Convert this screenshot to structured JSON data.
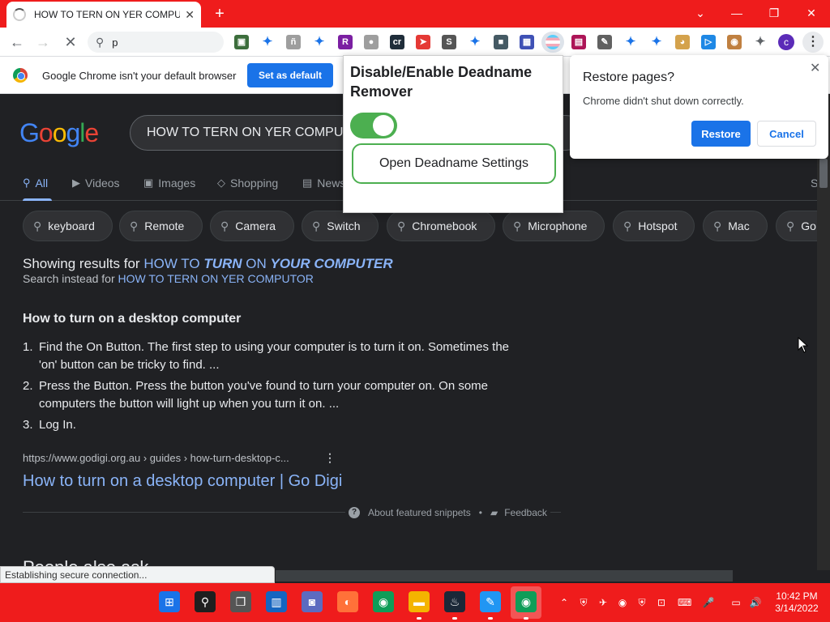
{
  "window": {
    "tab_title": "HOW TO TERN ON YER COMPUTOR",
    "tab_close": "✕",
    "new_tab": "+",
    "minimize": "—",
    "restore": "❐",
    "close": "✕",
    "dropdown": "⌄"
  },
  "toolbar": {
    "back": "←",
    "forward": "→",
    "reload": "✕",
    "omnibox_value": "p",
    "avatar_letter": "c",
    "menu": "⋮",
    "extensions": [
      {
        "name": "ext-1",
        "glyph": "▣",
        "color": "#3c6e3c"
      },
      {
        "name": "ext-puzzle-1",
        "glyph": "✦",
        "color": "#1a73e8"
      },
      {
        "name": "ext-3",
        "glyph": "ñ",
        "color": "#9e9e9e"
      },
      {
        "name": "ext-puzzle-2",
        "glyph": "✦",
        "color": "#1a73e8"
      },
      {
        "name": "ext-r",
        "glyph": "R",
        "color": "#7b1fa2"
      },
      {
        "name": "ext-6",
        "glyph": "●",
        "color": "#9e9e9e"
      },
      {
        "name": "ext-cr",
        "glyph": "cr",
        "color": "#1f2d3a"
      },
      {
        "name": "ext-8",
        "glyph": "➤",
        "color": "#e53935"
      },
      {
        "name": "ext-s",
        "glyph": "S",
        "color": "#555555"
      },
      {
        "name": "ext-puzzle-3",
        "glyph": "✦",
        "color": "#1a73e8"
      },
      {
        "name": "ext-11",
        "glyph": "■",
        "color": "#455a64"
      },
      {
        "name": "ext-12",
        "glyph": "▦",
        "color": "#3f51b5"
      },
      {
        "name": "ext-13",
        "glyph": "▤",
        "color": "#ad1457"
      },
      {
        "name": "ext-14",
        "glyph": "✎",
        "color": "#616161"
      },
      {
        "name": "ext-puzzle-4",
        "glyph": "✦",
        "color": "#1a73e8"
      },
      {
        "name": "ext-puzzle-5",
        "glyph": "✦",
        "color": "#1a73e8"
      },
      {
        "name": "ext-doge",
        "glyph": "◕",
        "color": "#d4a24c"
      },
      {
        "name": "ext-play",
        "glyph": "▷",
        "color": "#1e88e5"
      },
      {
        "name": "ext-19",
        "glyph": "◉",
        "color": "#c08040"
      },
      {
        "name": "ext-puzzle-menu",
        "glyph": "✦",
        "color": "#5f6368"
      }
    ]
  },
  "infobar": {
    "message": "Google Chrome isn't your default browser",
    "button": "Set as default"
  },
  "search": {
    "query": "HOW TO TERN ON YER COMPUTOR",
    "tabs": [
      {
        "label": "All",
        "icon": "⚲"
      },
      {
        "label": "Videos",
        "icon": "▶"
      },
      {
        "label": "Images",
        "icon": "▣"
      },
      {
        "label": "Shopping",
        "icon": "◇"
      },
      {
        "label": "News",
        "icon": "▤"
      }
    ],
    "tab_more": "S",
    "chips": [
      "keyboard",
      "Remote",
      "Camera",
      "Switch",
      "Chromebook",
      "Microphone",
      "Hotspot",
      "Mac",
      "Go"
    ],
    "showing_prefix": "Showing results for",
    "corrected": [
      "HOW TO",
      "TURN",
      "ON",
      "YOUR COMPUTER"
    ],
    "instead_prefix": "Search instead for",
    "instead_query": "HOW TO TERN ON YER COMPUTOR",
    "snippet_title": "How to turn on a desktop computer",
    "steps": [
      {
        "num": "1.",
        "text": "Find the On Button. The first step to using your computer is to turn it on. Sometimes the 'on' button can be tricky to find. ..."
      },
      {
        "num": "2.",
        "text": "Press the Button. Press the button you've found to turn your computer on. On some computers the button will light up when you turn it on. ..."
      },
      {
        "num": "3.",
        "text": "Log In."
      }
    ],
    "cite": "https://www.godigi.org.au › guides › how-turn-desktop-c...",
    "cite_menu": "⋮",
    "result_title": "How to turn on a desktop computer | Go Digi",
    "about_snippets": "About featured snippets",
    "about_sep": "•",
    "feedback": "Feedback",
    "people_also_ask": "People also ask"
  },
  "status": "Establishing secure connection...",
  "ext_popup": {
    "title": "Disable/Enable Deadname Remover",
    "toggle_on": true,
    "settings_button": "Open Deadname Settings"
  },
  "restore_dialog": {
    "title": "Restore pages?",
    "message": "Chrome didn't shut down correctly.",
    "restore": "Restore",
    "cancel": "Cancel",
    "close": "✕"
  },
  "taskbar": {
    "apps": [
      {
        "name": "windows-start",
        "glyph": "⊞",
        "color": "#1a73e8"
      },
      {
        "name": "search",
        "glyph": "⚲",
        "color": "#1f1f1f"
      },
      {
        "name": "task-view",
        "glyph": "❒",
        "color": "#555555"
      },
      {
        "name": "widgets",
        "glyph": "▥",
        "color": "#1565c0"
      },
      {
        "name": "chat",
        "glyph": "◙",
        "color": "#5c6bc0"
      },
      {
        "name": "firefox",
        "glyph": "◐",
        "color": "#ff7139"
      },
      {
        "name": "chrome",
        "glyph": "◉",
        "color": "#0f9d58"
      },
      {
        "name": "file-explorer",
        "glyph": "▬",
        "color": "#f4b400"
      },
      {
        "name": "steam",
        "glyph": "♨",
        "color": "#1b2838"
      },
      {
        "name": "notepad",
        "glyph": "✎",
        "color": "#2196f3"
      },
      {
        "name": "chrome-active",
        "glyph": "◉",
        "color": "#0f9d58"
      }
    ],
    "tray": [
      "⌃",
      "⛨",
      "✈",
      "◉",
      "⛨",
      "⊡",
      "⌨",
      "🎤",
      "▭",
      "🔊"
    ],
    "time": "10:42 PM",
    "date": "3/14/2022"
  }
}
